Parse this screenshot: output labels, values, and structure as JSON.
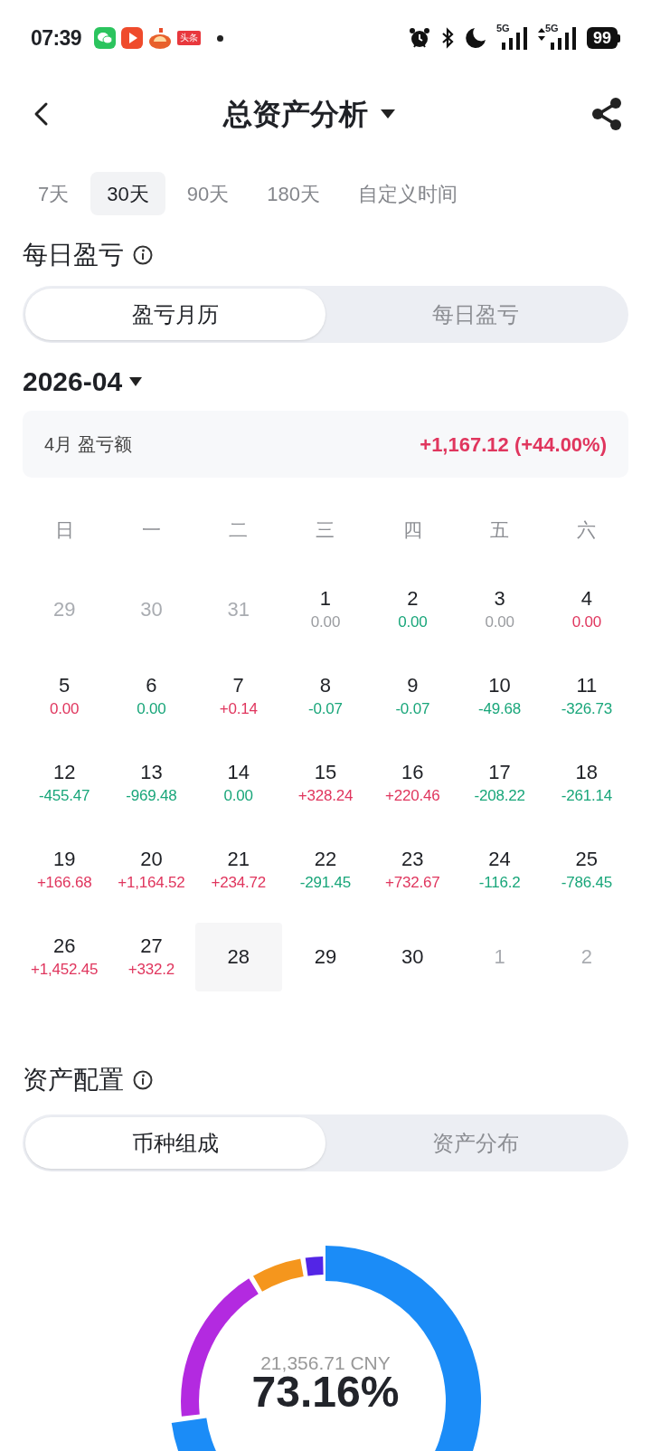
{
  "status_bar": {
    "time": "07:39",
    "app_badge": "头条",
    "network_1": "5G",
    "network_2": "5G",
    "battery": "99"
  },
  "header": {
    "title": "总资产分析"
  },
  "range_tabs": [
    {
      "label": "7天",
      "selected": false
    },
    {
      "label": "30天",
      "selected": true
    },
    {
      "label": "90天",
      "selected": false
    },
    {
      "label": "180天",
      "selected": false
    },
    {
      "label": "自定义时间",
      "selected": false
    }
  ],
  "daily_pnl": {
    "title": "每日盈亏",
    "segments": [
      {
        "label": "盈亏月历",
        "selected": true
      },
      {
        "label": "每日盈亏",
        "selected": false
      }
    ],
    "month": "2026-04",
    "summary": {
      "label": "4月 盈亏额",
      "value": "+1,167.12 (+44.00%)",
      "color": "#e0365e"
    },
    "weekdays": [
      "日",
      "一",
      "二",
      "三",
      "四",
      "五",
      "六"
    ],
    "weeks": [
      [
        {
          "day": "29",
          "other_month": true,
          "selected": false
        },
        {
          "day": "30",
          "other_month": true,
          "selected": false
        },
        {
          "day": "31",
          "other_month": true,
          "selected": false
        },
        {
          "day": "1",
          "value": "0.00",
          "color": "#9a9ca0",
          "other_month": false,
          "selected": false
        },
        {
          "day": "2",
          "value": "0.00",
          "color": "#19a67a",
          "other_month": false,
          "selected": false
        },
        {
          "day": "3",
          "value": "0.00",
          "color": "#9a9ca0",
          "other_month": false,
          "selected": false
        },
        {
          "day": "4",
          "value": "0.00",
          "color": "#e0365e",
          "other_month": false,
          "selected": false
        }
      ],
      [
        {
          "day": "5",
          "value": "0.00",
          "color": "#e0365e",
          "other_month": false,
          "selected": false
        },
        {
          "day": "6",
          "value": "0.00",
          "color": "#19a67a",
          "other_month": false,
          "selected": false
        },
        {
          "day": "7",
          "value": "+0.14",
          "color": "#e0365e",
          "other_month": false,
          "selected": false
        },
        {
          "day": "8",
          "value": "-0.07",
          "color": "#19a67a",
          "other_month": false,
          "selected": false
        },
        {
          "day": "9",
          "value": "-0.07",
          "color": "#19a67a",
          "other_month": false,
          "selected": false
        },
        {
          "day": "10",
          "value": "-49.68",
          "color": "#19a67a",
          "other_month": false,
          "selected": false
        },
        {
          "day": "11",
          "value": "-326.73",
          "color": "#19a67a",
          "other_month": false,
          "selected": false
        }
      ],
      [
        {
          "day": "12",
          "value": "-455.47",
          "color": "#19a67a",
          "other_month": false,
          "selected": false
        },
        {
          "day": "13",
          "value": "-969.48",
          "color": "#19a67a",
          "other_month": false,
          "selected": false
        },
        {
          "day": "14",
          "value": "0.00",
          "color": "#19a67a",
          "other_month": false,
          "selected": false
        },
        {
          "day": "15",
          "value": "+328.24",
          "color": "#e0365e",
          "other_month": false,
          "selected": false
        },
        {
          "day": "16",
          "value": "+220.46",
          "color": "#e0365e",
          "other_month": false,
          "selected": false
        },
        {
          "day": "17",
          "value": "-208.22",
          "color": "#19a67a",
          "other_month": false,
          "selected": false
        },
        {
          "day": "18",
          "value": "-261.14",
          "color": "#19a67a",
          "other_month": false,
          "selected": false
        }
      ],
      [
        {
          "day": "19",
          "value": "+166.68",
          "color": "#e0365e",
          "other_month": false,
          "selected": false
        },
        {
          "day": "20",
          "value": "+1,164.52",
          "color": "#e0365e",
          "other_month": false,
          "selected": false
        },
        {
          "day": "21",
          "value": "+234.72",
          "color": "#e0365e",
          "other_month": false,
          "selected": false
        },
        {
          "day": "22",
          "value": "-291.45",
          "color": "#19a67a",
          "other_month": false,
          "selected": false
        },
        {
          "day": "23",
          "value": "+732.67",
          "color": "#e0365e",
          "other_month": false,
          "selected": false
        },
        {
          "day": "24",
          "value": "-116.2",
          "color": "#19a67a",
          "other_month": false,
          "selected": false
        },
        {
          "day": "25",
          "value": "-786.45",
          "color": "#19a67a",
          "other_month": false,
          "selected": false
        }
      ],
      [
        {
          "day": "26",
          "value": "+1,452.45",
          "color": "#e0365e",
          "other_month": false,
          "selected": false
        },
        {
          "day": "27",
          "value": "+332.2",
          "color": "#e0365e",
          "other_month": false,
          "selected": false
        },
        {
          "day": "28",
          "other_month": false,
          "selected": true
        },
        {
          "day": "29",
          "other_month": false,
          "selected": false
        },
        {
          "day": "30",
          "other_month": false,
          "selected": false
        },
        {
          "day": "1",
          "other_month": true,
          "selected": false
        },
        {
          "day": "2",
          "other_month": true,
          "selected": false
        }
      ]
    ]
  },
  "allocation": {
    "title": "资产配置",
    "segments": [
      {
        "label": "币种组成",
        "selected": true
      },
      {
        "label": "资产分布",
        "selected": false
      }
    ],
    "donut": {
      "amount": "21,356.71 CNY",
      "percent": "73.16%"
    }
  }
}
